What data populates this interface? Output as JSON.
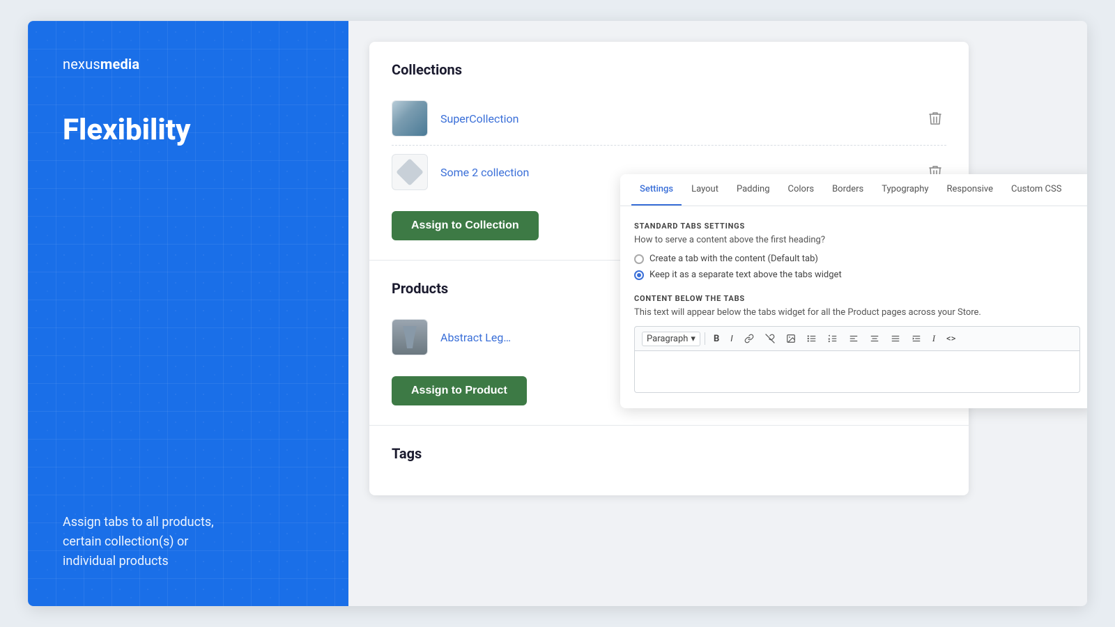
{
  "brand": {
    "prefix": "nexus",
    "suffix": "media"
  },
  "left": {
    "tagline": "Flexibility",
    "description": "Assign tabs to all products,\ncertain collection(s) or\nindividual products"
  },
  "collections": {
    "title": "Collections",
    "items": [
      {
        "id": 1,
        "name": "SuperCollection",
        "thumb_type": "landscape"
      },
      {
        "id": 2,
        "name": "Some 2 collection",
        "thumb_type": "diamond"
      }
    ],
    "assign_button": "Assign to Collection"
  },
  "products": {
    "title": "Products",
    "items": [
      {
        "id": 1,
        "name": "Abstract Leg…",
        "thumb_type": "pants"
      }
    ],
    "assign_button": "Assign to Product"
  },
  "tags": {
    "title": "Tags"
  },
  "settings": {
    "tabs": [
      "Settings",
      "Layout",
      "Padding",
      "Colors",
      "Borders",
      "Typography",
      "Responsive",
      "Custom CSS"
    ],
    "active_tab": "Settings",
    "section1_title": "STANDARD TABS SETTINGS",
    "section1_subtitle": "How to serve a content above the first heading?",
    "radio_options": [
      {
        "label": "Create a tab with the content (Default tab)",
        "selected": false
      },
      {
        "label": "Keep it as a separate text above the tabs widget",
        "selected": true
      }
    ],
    "section2_title": "CONTENT BELOW THE TABS",
    "section2_subtitle": "This text will appear below the tabs widget for all the Product pages across your Store.",
    "toolbar_items": [
      "Paragraph",
      "▾",
      "B",
      "I",
      "🔗",
      "🔗",
      "🖼",
      "≡",
      "≡",
      "⬤",
      "⬤",
      "⬤",
      "I",
      "<>"
    ]
  }
}
